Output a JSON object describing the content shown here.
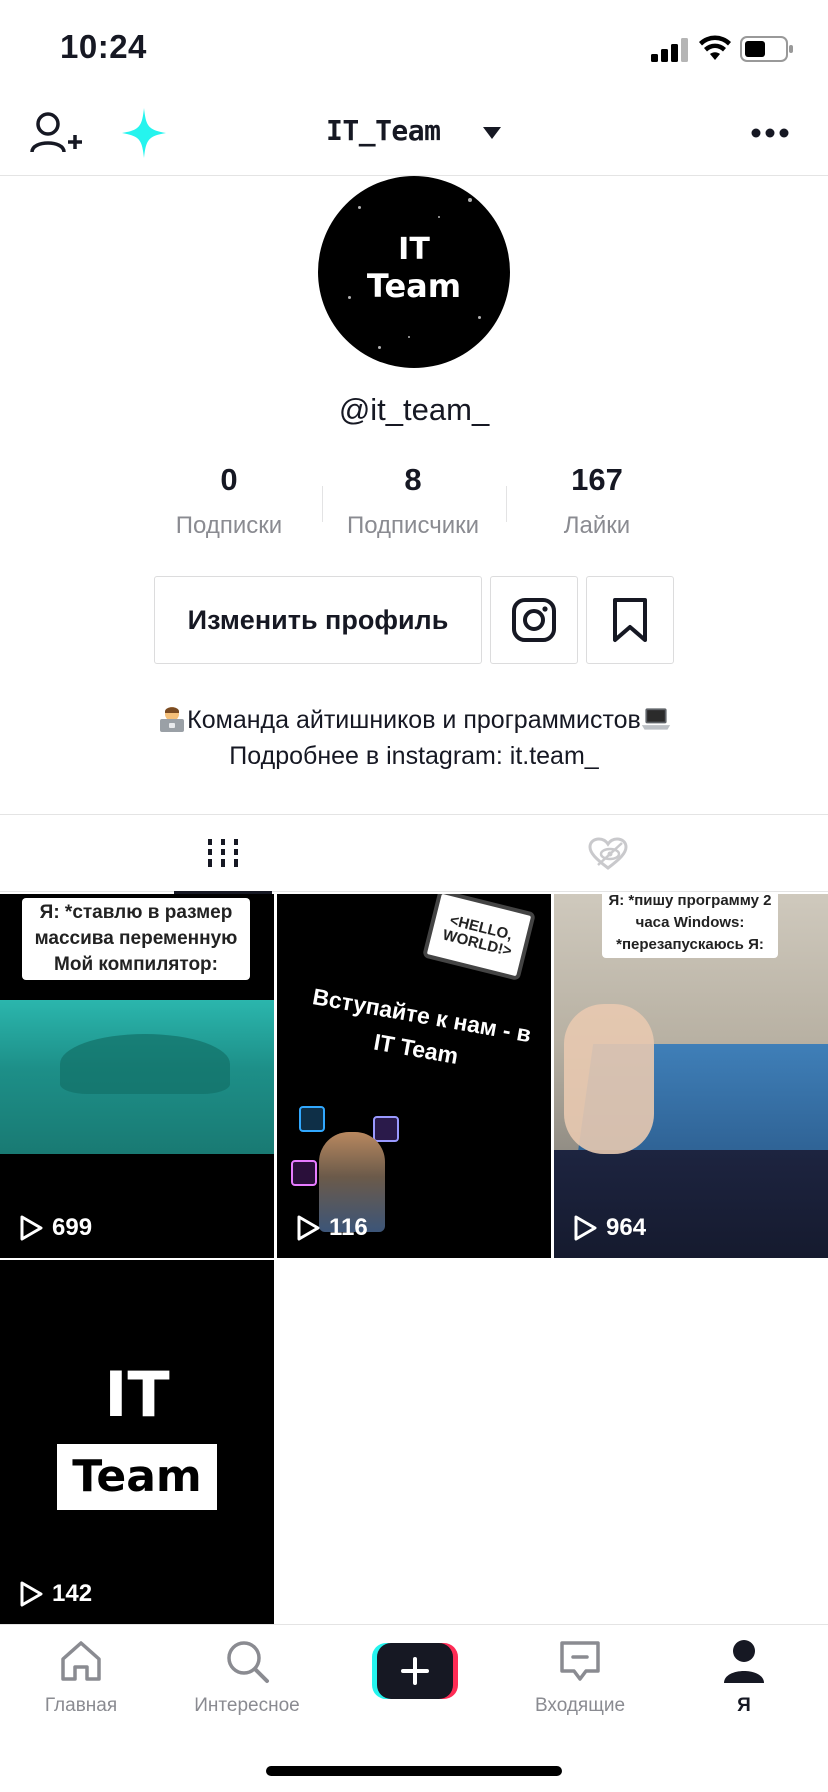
{
  "status_bar": {
    "time": "10:24"
  },
  "header": {
    "title": "IT_Team"
  },
  "profile": {
    "avatar_line1": "IT",
    "avatar_line2": "Team",
    "username": "@it_team_"
  },
  "stats": [
    {
      "value": "0",
      "label": "Подписки"
    },
    {
      "value": "8",
      "label": "Подписчики"
    },
    {
      "value": "167",
      "label": "Лайки"
    }
  ],
  "actions": {
    "edit_profile": "Изменить профиль"
  },
  "bio": {
    "line1": "Команда айтишников и программистов",
    "line2": "Подробнее в instagram: it.team_"
  },
  "videos": [
    {
      "views": "699",
      "caption": "Я: *ставлю в размер массива переменную Мой компилятор:"
    },
    {
      "views": "116",
      "caption": "Вступайте к нам - в IT Team",
      "sign": "<HELLO, WORLD!>"
    },
    {
      "views": "964",
      "caption": "Я: *пишу программу 2 часа Windows: *перезапускаюсь Я:"
    },
    {
      "views": "142",
      "line1": "IT",
      "line2": "Team"
    }
  ],
  "nav": {
    "home": "Главная",
    "discover": "Интересное",
    "inbox": "Входящие",
    "me": "Я"
  },
  "colors": {
    "accent_cyan": "#25F4EE",
    "accent_red": "#FE2C55",
    "text_dark": "#161823",
    "text_gray": "#8A8B91"
  }
}
